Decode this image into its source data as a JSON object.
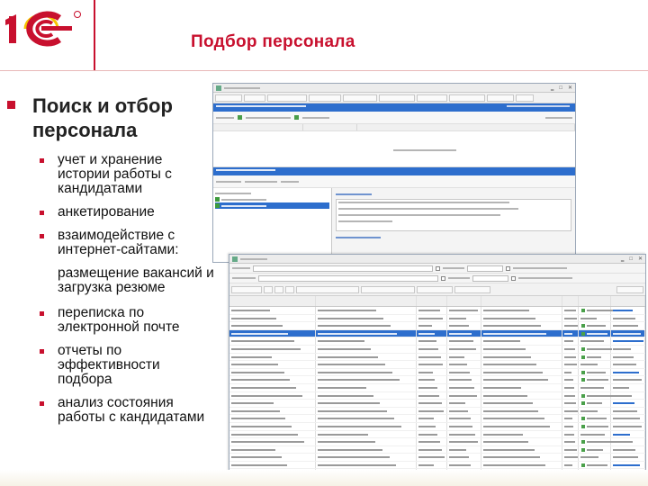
{
  "slide": {
    "title": "Подбор персонала",
    "main_bullet": "Поиск и отбор персонала",
    "sub_items": [
      "учет и хранение истории работы с кандидатами",
      "анкетирование",
      "взаимодействие с интернет-сайтами:"
    ],
    "sub_continuation": "размещение вакансий и загрузка резюме",
    "sub_items_after": [
      "переписка по электронной почте",
      "отчеты по эффективности подбора",
      "анализ состояния работы с кандидатами"
    ]
  },
  "colors": {
    "brand_red": "#c8102e",
    "logo_yellow": "#f6c400",
    "header_blue": "#2d6ecd"
  },
  "icons": [
    "logo-1c",
    "app-icon",
    "minimize-icon",
    "maximize-icon",
    "close-icon",
    "green-status-icon"
  ]
}
